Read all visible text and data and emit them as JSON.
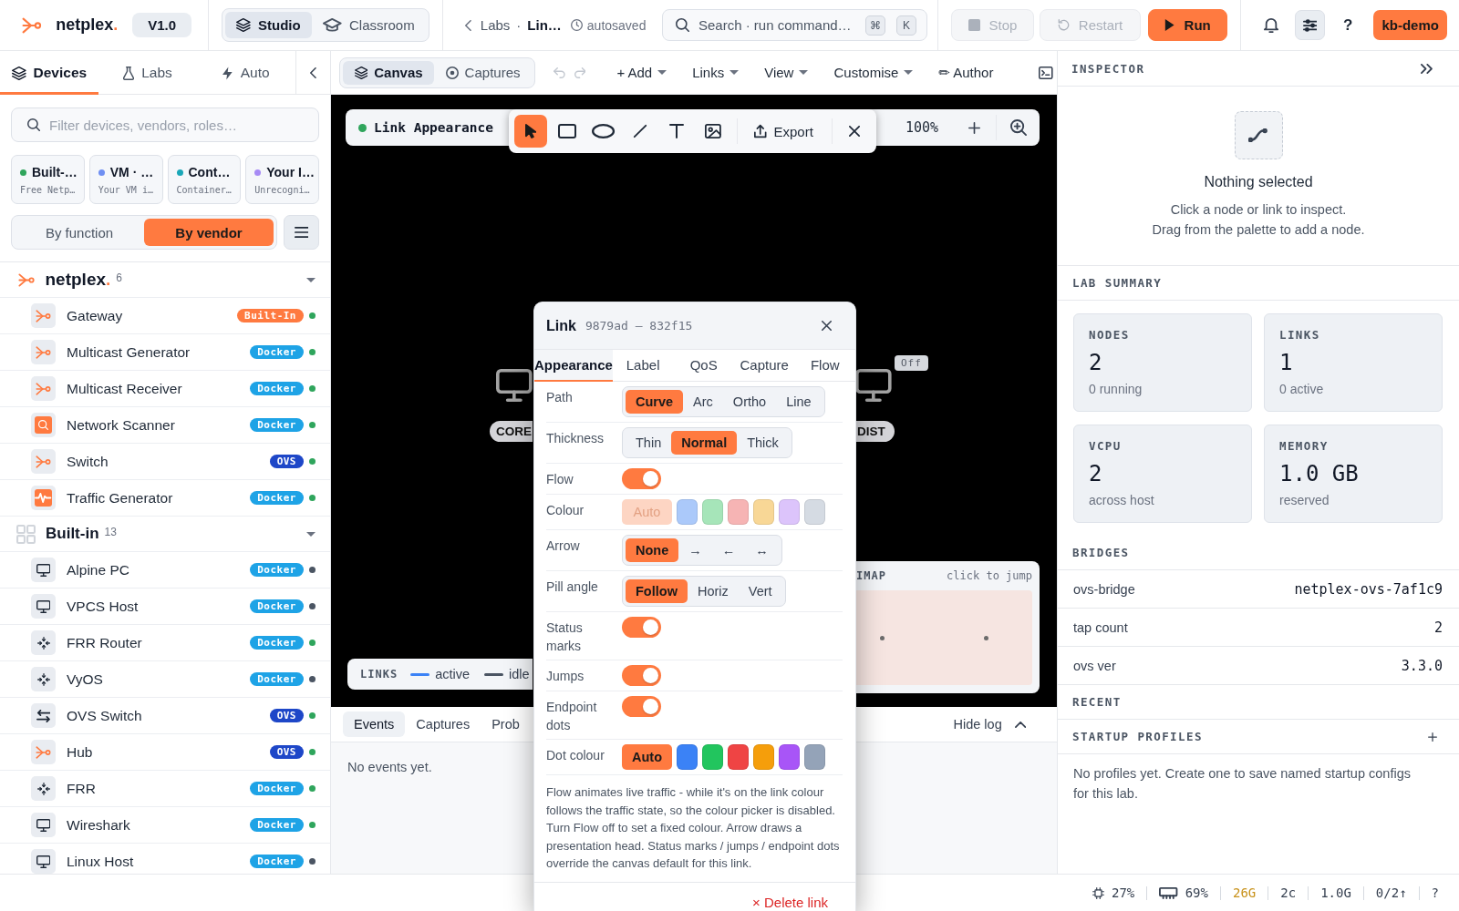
{
  "topbar": {
    "brand": {
      "name": "netplex",
      "accent": "."
    },
    "version": "V1.0",
    "modes": [
      {
        "label": "Studio",
        "kind": "layers",
        "selected": true
      },
      {
        "label": "Classroom",
        "kind": "cap",
        "selected": false
      }
    ],
    "breadcrumb": {
      "parent": "Labs",
      "separator": "·",
      "current": "Lin…",
      "status": "autosaved"
    },
    "search": {
      "placeholder": "Search · run command…",
      "keys": [
        "⌘",
        "K"
      ]
    },
    "actions": [
      {
        "label": "Stop",
        "kind": "stop",
        "disabled": true
      },
      {
        "label": "Restart",
        "kind": "restart",
        "disabled": true
      },
      {
        "label": "Run",
        "kind": "run",
        "disabled": false
      }
    ],
    "help": "?",
    "user": "kb-demo"
  },
  "sidebar": {
    "tabs": [
      {
        "label": "Devices",
        "kind": "layers",
        "selected": true
      },
      {
        "label": "Labs",
        "kind": "flask",
        "selected": false
      },
      {
        "label": "Auto",
        "kind": "bolt",
        "selected": false
      }
    ],
    "filter": {
      "placeholder": "Filter devices, vendors, roles…"
    },
    "sources": [
      {
        "title": "Built-…",
        "subtitle": "Free Netp…",
        "color": "#2fa55c"
      },
      {
        "title": "VM · …",
        "subtitle": "Your VM i…",
        "color": "#6f8ff2"
      },
      {
        "title": "Cont…",
        "subtitle": "Container…",
        "color": "#1aa7b8"
      },
      {
        "title": "Your I…",
        "subtitle": "Unrecogni…",
        "color": "#a78bf5"
      }
    ],
    "grouping": [
      {
        "label": "By function",
        "selected": false
      },
      {
        "label": "By vendor",
        "selected": true
      }
    ],
    "groups": [
      {
        "name": "netplex",
        "accent": ".",
        "count": "6",
        "kind": "vendor",
        "expanded": true,
        "items": [
          {
            "name": "Gateway",
            "kind": "netplex",
            "tag": {
              "label": "Built-In",
              "color": "#ff7a40"
            },
            "color": "#2fa55c"
          },
          {
            "name": "Multicast Generator",
            "kind": "netplex",
            "tag": {
              "label": "Docker",
              "color": "#1ea3e6"
            },
            "color": "#2fa55c"
          },
          {
            "name": "Multicast Receiver",
            "kind": "netplex",
            "tag": {
              "label": "Docker",
              "color": "#1ea3e6"
            },
            "color": "#2fa55c"
          },
          {
            "name": "Network Scanner",
            "kind": "scanner",
            "tag": {
              "label": "Docker",
              "color": "#1ea3e6"
            },
            "color": "#2fa55c"
          },
          {
            "name": "Switch",
            "kind": "netplex",
            "tag": {
              "label": "OVS",
              "color": "#1e47c8"
            },
            "color": "#2fa55c"
          },
          {
            "name": "Traffic Generator",
            "kind": "traffic",
            "tag": {
              "label": "Docker",
              "color": "#1ea3e6"
            },
            "color": "#2fa55c"
          }
        ]
      },
      {
        "name": "Built-in",
        "count": "13",
        "kind": "builtin",
        "expanded": true,
        "items": [
          {
            "name": "Alpine PC",
            "kind": "monitor",
            "tag": {
              "label": "Docker",
              "color": "#1ea3e6"
            },
            "color": "#4b5563"
          },
          {
            "name": "VPCS Host",
            "kind": "monitor",
            "tag": {
              "label": "Docker",
              "color": "#1ea3e6"
            },
            "color": "#4b5563"
          },
          {
            "name": "FRR Router",
            "kind": "router",
            "tag": {
              "label": "Docker",
              "color": "#1ea3e6"
            },
            "color": "#2fa55c"
          },
          {
            "name": "VyOS",
            "kind": "router",
            "tag": {
              "label": "Docker",
              "color": "#1ea3e6"
            },
            "color": "#4b5563"
          },
          {
            "name": "OVS Switch",
            "kind": "switch",
            "tag": {
              "label": "OVS",
              "color": "#1e47c8"
            },
            "color": "#2fa55c"
          },
          {
            "name": "Hub",
            "kind": "netplex",
            "tag": {
              "label": "OVS",
              "color": "#1e47c8"
            },
            "color": "#2fa55c"
          },
          {
            "name": "FRR",
            "kind": "router",
            "tag": {
              "label": "Docker",
              "color": "#1ea3e6"
            },
            "color": "#2fa55c"
          },
          {
            "name": "Wireshark",
            "kind": "monitor",
            "tag": {
              "label": "Docker",
              "color": "#1ea3e6"
            },
            "color": "#2fa55c"
          },
          {
            "name": "Linux Host",
            "kind": "monitor",
            "tag": {
              "label": "Docker",
              "color": "#1ea3e6"
            },
            "color": "#4b5563"
          }
        ]
      }
    ]
  },
  "workspace": {
    "views": [
      {
        "label": "Canvas",
        "kind": "layers",
        "selected": true
      },
      {
        "label": "Captures",
        "kind": "target",
        "selected": false
      }
    ],
    "history": [
      {
        "kind": "undo",
        "disabled": true
      },
      {
        "kind": "redo",
        "disabled": true
      }
    ],
    "menus": [
      {
        "label": "+ Add",
        "dropdown": true
      },
      {
        "label": "Links",
        "dropdown": true
      },
      {
        "label": "View",
        "dropdown": true
      },
      {
        "label": "Customise",
        "dropdown": true
      },
      {
        "label": "✏ Author",
        "dropdown": false
      }
    ],
    "canvas": {
      "title": {
        "text": "Link Appearance",
        "color": "#2fa55c"
      },
      "tools": [
        {
          "kind": "pointer",
          "selected": true
        },
        {
          "kind": "rectangle",
          "selected": false
        },
        {
          "kind": "ellipse",
          "selected": false
        },
        {
          "kind": "line",
          "selected": false
        },
        {
          "kind": "text",
          "selected": false
        },
        {
          "kind": "image",
          "selected": false
        }
      ],
      "export": "Export",
      "zoom": "100%",
      "nodes": [
        {
          "label": "CORE"
        },
        {
          "label": "DIST",
          "badge": "Off"
        }
      ],
      "legend": {
        "title": "LINKS",
        "items": [
          {
            "label": "active",
            "color": "#3b82f6"
          },
          {
            "label": "idle",
            "color": "#4b5563"
          }
        ]
      },
      "minimap": {
        "title": "IMAP",
        "hint": "click to jump"
      }
    },
    "log": {
      "tabs": [
        {
          "label": "Events",
          "selected": true
        },
        {
          "label": "Captures",
          "selected": false
        },
        {
          "label": "Prob",
          "selected": false
        }
      ],
      "toggle": "Hide log",
      "empty": "No events yet."
    }
  },
  "link_dialog": {
    "title": "Link",
    "ids": "9879ad — 832f15",
    "tabs": [
      {
        "label": "Appearance",
        "selected": true
      },
      {
        "label": "Label",
        "selected": false
      },
      {
        "label": "QoS",
        "selected": false
      },
      {
        "label": "Capture",
        "selected": false
      },
      {
        "label": "Flow",
        "selected": false
      }
    ],
    "rows": [
      {
        "label": "Path",
        "kind": "segmented",
        "options": [
          {
            "label": "Curve",
            "selected": true
          },
          {
            "label": "Arc",
            "selected": false
          },
          {
            "label": "Ortho",
            "selected": false
          },
          {
            "label": "Line",
            "selected": false
          }
        ]
      },
      {
        "label": "Thickness",
        "kind": "segmented",
        "options": [
          {
            "label": "Thin",
            "selected": false
          },
          {
            "label": "Normal",
            "selected": true
          },
          {
            "label": "Thick",
            "selected": false
          }
        ]
      },
      {
        "label": "Flow",
        "kind": "toggle",
        "on": true
      },
      {
        "label": "Colour",
        "kind": "swatches",
        "disabled": true,
        "options": [
          {
            "kind": "auto",
            "label": "Auto",
            "selected": true
          },
          {
            "kind": "swatch",
            "color": "#abc9fa",
            "selected": false
          },
          {
            "kind": "swatch",
            "color": "#a6e5b9",
            "selected": false
          },
          {
            "kind": "swatch",
            "color": "#f6b4b4",
            "selected": false
          },
          {
            "kind": "swatch",
            "color": "#f8d796",
            "selected": false
          },
          {
            "kind": "swatch",
            "color": "#dcc4fb",
            "selected": false
          },
          {
            "kind": "swatch",
            "color": "#d5dbe3",
            "selected": false
          }
        ]
      },
      {
        "label": "Arrow",
        "kind": "segmented",
        "options": [
          {
            "label": "None",
            "selected": true
          },
          {
            "label": "→",
            "selected": false
          },
          {
            "label": "←",
            "selected": false
          },
          {
            "label": "↔",
            "selected": false
          }
        ]
      },
      {
        "label": "Pill angle",
        "kind": "segmented",
        "options": [
          {
            "label": "Follow",
            "selected": true
          },
          {
            "label": "Horiz",
            "selected": false
          },
          {
            "label": "Vert",
            "selected": false
          }
        ]
      },
      {
        "label": "Status marks",
        "kind": "toggle",
        "on": true
      },
      {
        "label": "Jumps",
        "kind": "toggle",
        "on": true
      },
      {
        "label": "Endpoint dots",
        "kind": "toggle",
        "on": true
      },
      {
        "label": "Dot colour",
        "kind": "swatches",
        "disabled": false,
        "options": [
          {
            "kind": "auto",
            "label": "Auto",
            "selected": true
          },
          {
            "kind": "swatch",
            "color": "#3b82f6",
            "selected": false
          },
          {
            "kind": "swatch",
            "color": "#22c55e",
            "selected": false
          },
          {
            "kind": "swatch",
            "color": "#ef4444",
            "selected": false
          },
          {
            "kind": "swatch",
            "color": "#f59e0b",
            "selected": false
          },
          {
            "kind": "swatch",
            "color": "#a855f7",
            "selected": false
          },
          {
            "kind": "swatch",
            "color": "#94a3b8",
            "selected": false
          }
        ]
      }
    ],
    "note": "Flow animates live traffic - while it's on the link colour follows the traffic state, so the colour picker is disabled. Turn Flow off to set a fixed colour. Arrow draws a presentation head. Status marks / jumps / endpoint dots override the canvas default for this link.",
    "delete": "× Delete link"
  },
  "inspector": {
    "title": "INSPECTOR",
    "empty": {
      "title": "Nothing selected",
      "lines": [
        "Click a node or link to inspect.",
        "Drag from the palette to add a node."
      ]
    },
    "summary": {
      "title": "LAB SUMMARY",
      "cards": [
        {
          "label": "NODES",
          "value": "2",
          "sub": "0 running"
        },
        {
          "label": "LINKS",
          "value": "1",
          "sub": "0 active"
        },
        {
          "label": "VCPU",
          "value": "2",
          "sub": "across host"
        },
        {
          "label": "MEMORY",
          "value": "1.0 GB",
          "sub": "reserved"
        }
      ]
    },
    "bridges": {
      "title": "BRIDGES",
      "rows": [
        {
          "key": "ovs-bridge",
          "value": "netplex-ovs-7af1c9"
        },
        {
          "key": "tap count",
          "value": "2"
        },
        {
          "key": "ovs ver",
          "value": "3.3.0"
        }
      ]
    },
    "recent": {
      "title": "RECENT"
    },
    "profiles": {
      "title": "STARTUP PROFILES",
      "empty": "No profiles yet. Create one to save named startup configs for this lab."
    }
  },
  "status_bar": {
    "metrics": [
      {
        "kind": "cpu",
        "text": "27%",
        "warning": false
      },
      {
        "kind": "memory",
        "text": "69%",
        "warning": false
      },
      {
        "kind": "plain",
        "text": "26G",
        "warning": true
      },
      {
        "kind": "plain",
        "text": "2c",
        "warning": false
      },
      {
        "kind": "plain",
        "text": "1.0G",
        "warning": false
      },
      {
        "kind": "plain",
        "text": "0/2↑",
        "warning": false
      }
    ],
    "help": "?"
  }
}
